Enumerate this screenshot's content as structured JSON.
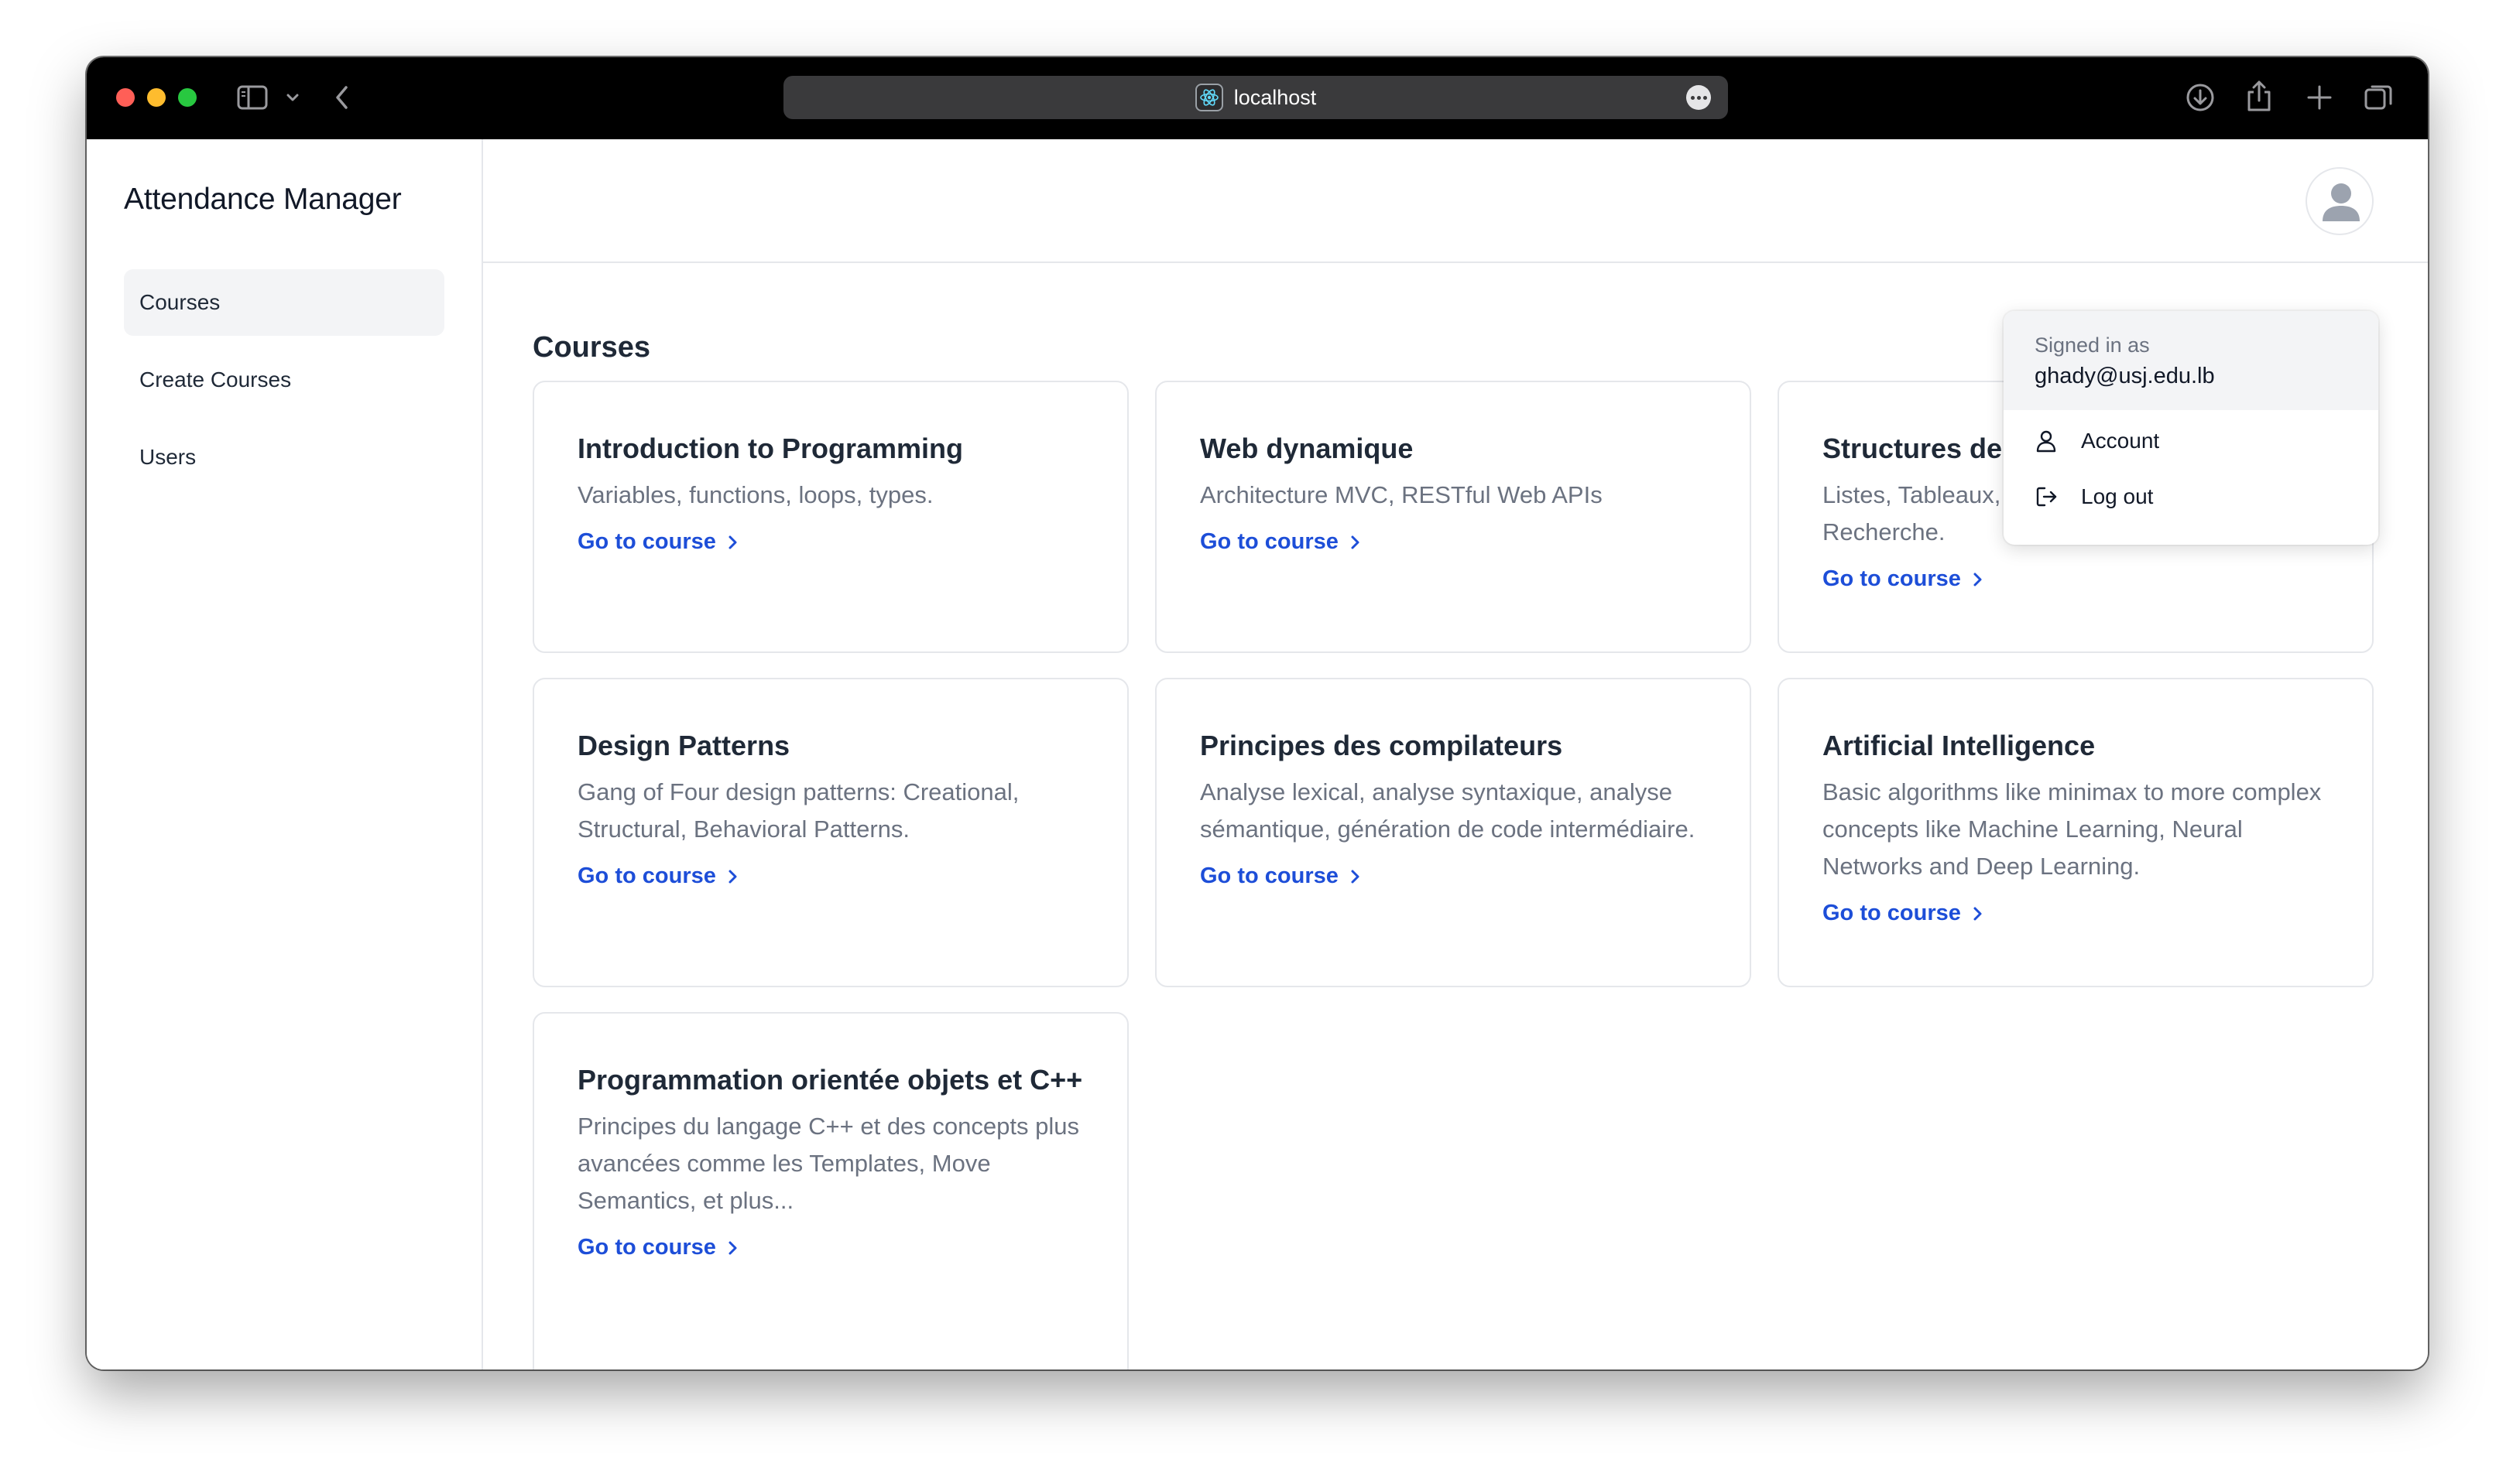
{
  "browser": {
    "url": "localhost"
  },
  "app": {
    "title": "Attendance Manager"
  },
  "sidebar": {
    "items": [
      {
        "label": "Courses",
        "active": true
      },
      {
        "label": "Create Courses",
        "active": false
      },
      {
        "label": "Users",
        "active": false
      }
    ]
  },
  "main": {
    "page_title": "Courses",
    "courses": [
      {
        "title": "Introduction to Programming",
        "description": "Variables, functions, loops, types.",
        "link": "Go to course"
      },
      {
        "title": "Web dynamique",
        "description": "Architecture MVC, RESTful Web APIs",
        "link": "Go to course"
      },
      {
        "title": "Structures de",
        "description": "Listes, Tableaux, Arbres, Graphes, Tris, Recherche.",
        "link": "Go to course"
      },
      {
        "title": "Design Patterns",
        "description": "Gang of Four design patterns: Creational, Structural, Behavioral Patterns.",
        "link": "Go to course"
      },
      {
        "title": "Principes des compilateurs",
        "description": "Analyse lexical, analyse syntaxique, analyse sémantique, génération de code intermédiaire.",
        "link": "Go to course"
      },
      {
        "title": "Artificial Intelligence",
        "description": "Basic algorithms like minimax to more complex concepts like Machine Learning, Neural Networks and Deep Learning.",
        "link": "Go to course"
      },
      {
        "title": "Programmation orientée objets et C++",
        "description": "Principes du langage C++ et des concepts plus avancées comme les Templates, Move Semantics, et plus...",
        "link": "Go to course"
      }
    ]
  },
  "user_menu": {
    "signed_in_label": "Signed in as",
    "email": "ghady@usj.edu.lb",
    "items": [
      {
        "label": "Account",
        "icon": "user-icon"
      },
      {
        "label": "Log out",
        "icon": "logout-icon"
      }
    ]
  },
  "colors": {
    "link": "#1d4ed8",
    "nav_active_bg": "#f3f4f6",
    "text_primary": "#1f2937",
    "text_muted": "#6b7280"
  }
}
